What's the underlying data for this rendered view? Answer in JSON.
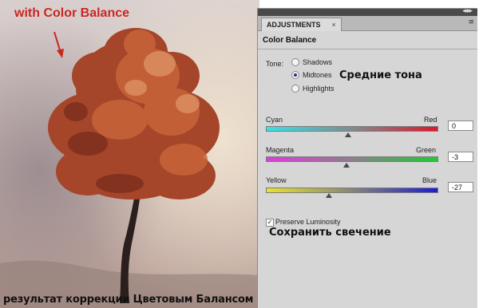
{
  "photo": {
    "top_annotation": "with Color Balance",
    "bottom_caption": "результат коррекции Цветовым Балансом"
  },
  "panel": {
    "tab_label": "ADJUSTMENTS",
    "tab_close": "×",
    "title": "Color Balance",
    "tone": {
      "label": "Tone:",
      "options": [
        "Shadows",
        "Midtones",
        "Highlights"
      ],
      "selected": "Midtones",
      "ru_annotation": "Средние тона"
    },
    "sliders": [
      {
        "left": "Cyan",
        "right": "Red",
        "value": "0",
        "level": 0.48
      },
      {
        "left": "Magenta",
        "right": "Green",
        "value": "-3",
        "level": 0.47
      },
      {
        "left": "Yellow",
        "right": "Blue",
        "value": "-27",
        "level": 0.37
      }
    ],
    "preserve": {
      "label": "Preserve Luminosity",
      "checked": true,
      "check_glyph": "✓",
      "ru_annotation": "Сохранить свечение"
    },
    "icons": {
      "collapse": "double-chevron-icon",
      "menu": "panel-menu-icon"
    },
    "glyphs": {
      "collapse": "◂◂ ▸▸",
      "menu": "≡"
    }
  }
}
